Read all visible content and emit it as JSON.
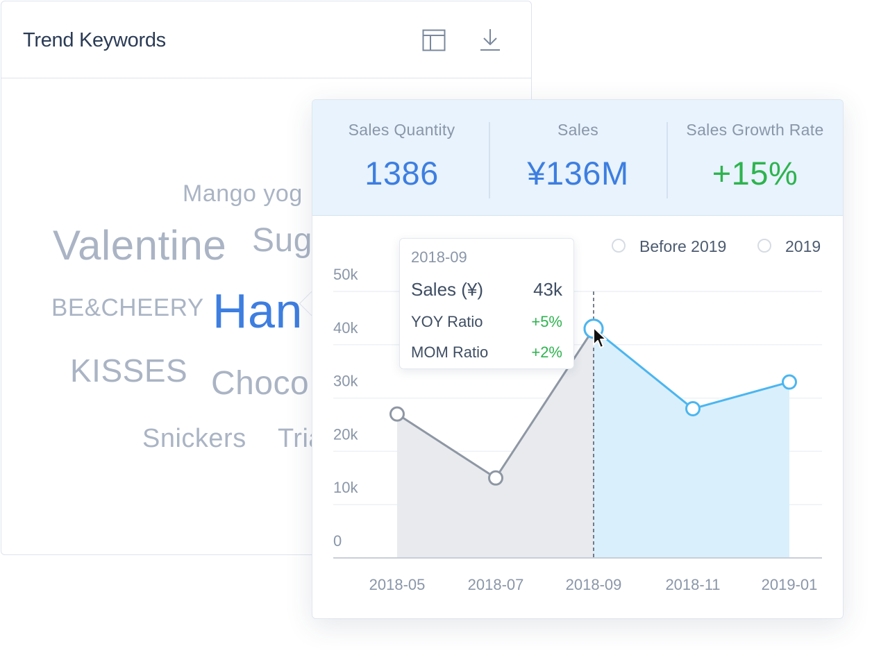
{
  "keywords_card": {
    "title": "Trend Keywords",
    "icons": [
      "layout-icon",
      "download-icon"
    ],
    "words": [
      {
        "text": "Mango yog",
        "color": "#aab4c4"
      },
      {
        "text": "Valentine",
        "color": "#aab4c4"
      },
      {
        "text": "Sug",
        "color": "#aab4c4"
      },
      {
        "text": "BE&CHEERY",
        "color": "#aab4c4"
      },
      {
        "text": "Han",
        "color": "#3d7ee0"
      },
      {
        "text": "KISSES",
        "color": "#aab4c4"
      },
      {
        "text": "Choco",
        "color": "#aab4c4"
      },
      {
        "text": "Snickers",
        "color": "#aab4c4"
      },
      {
        "text": "Tria",
        "color": "#aab4c4"
      }
    ]
  },
  "kpis": [
    {
      "label": "Sales Quantity",
      "value": "1386",
      "color": "#3d7ee0"
    },
    {
      "label": "Sales",
      "value": "¥136M",
      "color": "#3d7ee0"
    },
    {
      "label": "Sales Growth Rate",
      "value": "+15%",
      "color": "#2eb34f"
    }
  ],
  "legend": [
    {
      "label": "Before 2019"
    },
    {
      "label": "2019"
    }
  ],
  "tooltip": {
    "date": "2018-09",
    "rows": [
      {
        "label": "Sales (¥)",
        "value": "43k",
        "value_color": "#3f4e63"
      },
      {
        "label": "YOY Ratio",
        "value": "+5%",
        "value_color": "#2eb34f"
      },
      {
        "label": "MOM Ratio",
        "value": "+2%",
        "value_color": "#2eb34f"
      }
    ]
  },
  "chart_data": {
    "type": "area",
    "x_tick_labels": [
      "2018-05",
      "2018-07",
      "2018-09",
      "2018-11",
      "2019-01"
    ],
    "y_tick_labels": [
      "0",
      "10k",
      "20k",
      "30k",
      "40k",
      "50k"
    ],
    "ylim": [
      0,
      50000
    ],
    "grid": true,
    "hover_x": "2018-09",
    "series": [
      {
        "name": "Before 2019",
        "color": "#8e97a3",
        "fill": "#e8eaee",
        "x": [
          "2018-05",
          "2018-07",
          "2018-09"
        ],
        "values": [
          27000,
          15000,
          43000
        ]
      },
      {
        "name": "2019",
        "color": "#4bb6f0",
        "fill": "#daeffc",
        "x": [
          "2018-09",
          "2018-11",
          "2019-01"
        ],
        "values": [
          43000,
          28000,
          33000
        ]
      }
    ]
  }
}
